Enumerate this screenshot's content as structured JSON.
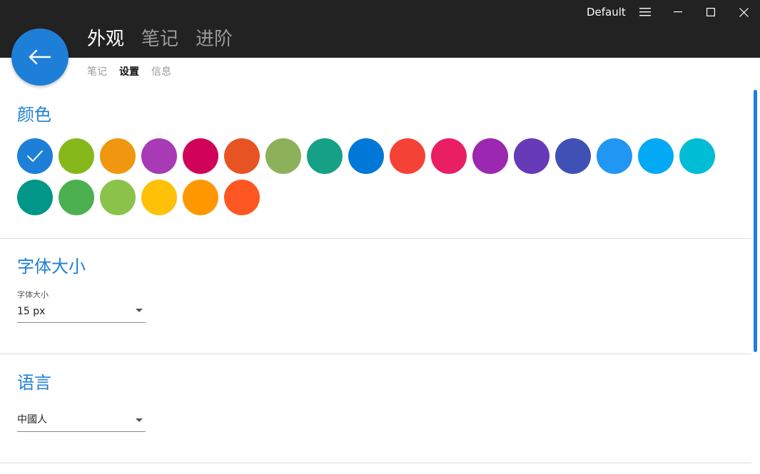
{
  "window": {
    "profile": "Default",
    "menu_icon": "hamburger-icon",
    "minimize_icon": "minimize-icon",
    "maximize_icon": "maximize-icon",
    "close_icon": "close-icon"
  },
  "back_button": {
    "icon": "arrow-left-icon"
  },
  "main_tabs": [
    {
      "label": "外观",
      "active": true
    },
    {
      "label": "笔记",
      "active": false
    },
    {
      "label": "进阶",
      "active": false
    }
  ],
  "sub_tabs": [
    {
      "label": "笔记",
      "active": false
    },
    {
      "label": "设置",
      "active": true
    },
    {
      "label": "信息",
      "active": false
    }
  ],
  "colors_section": {
    "title": "颜色",
    "selected_index": 0,
    "swatches": [
      "#1e7fd8",
      "#86b81b",
      "#f0960f",
      "#a93ab5",
      "#d0025a",
      "#e85323",
      "#8db15a",
      "#16a086",
      "#0078d7",
      "#f44336",
      "#e91e63",
      "#9c27b0",
      "#673ab7",
      "#3f51b5",
      "#2196f3",
      "#03a9f4",
      "#00bcd4",
      "#009688",
      "#4caf50",
      "#8bc34a",
      "#ffc107",
      "#ff9800",
      "#ff5722"
    ]
  },
  "font_section": {
    "title": "字体大小",
    "field_label": "字体大小",
    "value": "15 px"
  },
  "language_section": {
    "title": "语言",
    "value": "中國人"
  }
}
